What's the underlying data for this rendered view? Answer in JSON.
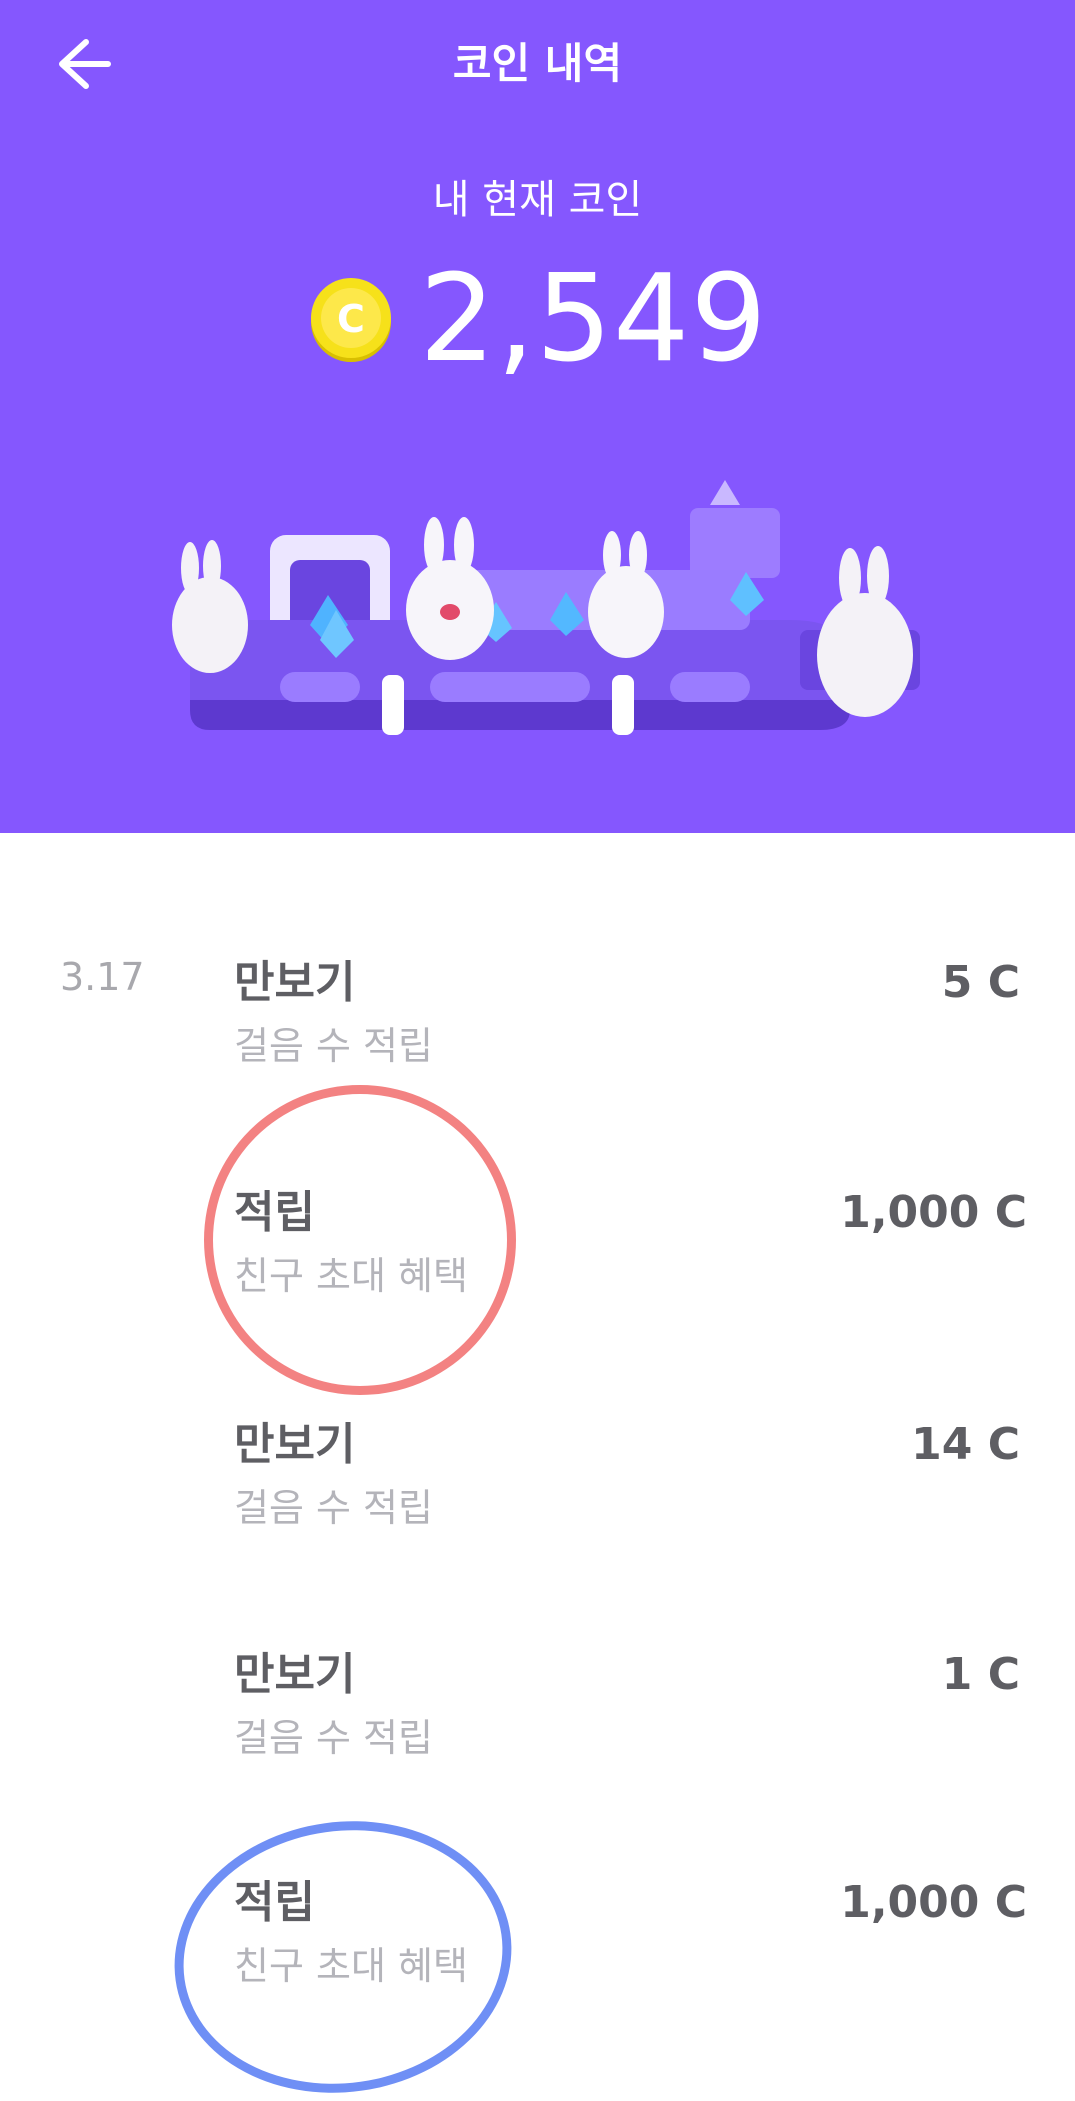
{
  "header": {
    "title": "코인 내역",
    "balance_label": "내 현재 코인",
    "balance_value": "2,549",
    "coin_glyph": "C",
    "back_icon": "arrow-left-icon",
    "background_color": "#8557fe"
  },
  "history": {
    "date": "3.17",
    "entries": [
      {
        "title": "만보기",
        "subtitle": "걸음 수 적립",
        "amount": "5 C"
      },
      {
        "title": "적립",
        "subtitle": "친구 초대 혜택",
        "amount": "1,000 C"
      },
      {
        "title": "만보기",
        "subtitle": "걸음 수 적립",
        "amount": "14 C"
      },
      {
        "title": "만보기",
        "subtitle": "걸음 수 적립",
        "amount": "1 C"
      },
      {
        "title": "적립",
        "subtitle": "친구 초대 혜택",
        "amount": "1,000 C"
      }
    ]
  },
  "annotations": {
    "red_circle_color": "#f38282",
    "blue_circle_color": "#6f8ff5"
  }
}
